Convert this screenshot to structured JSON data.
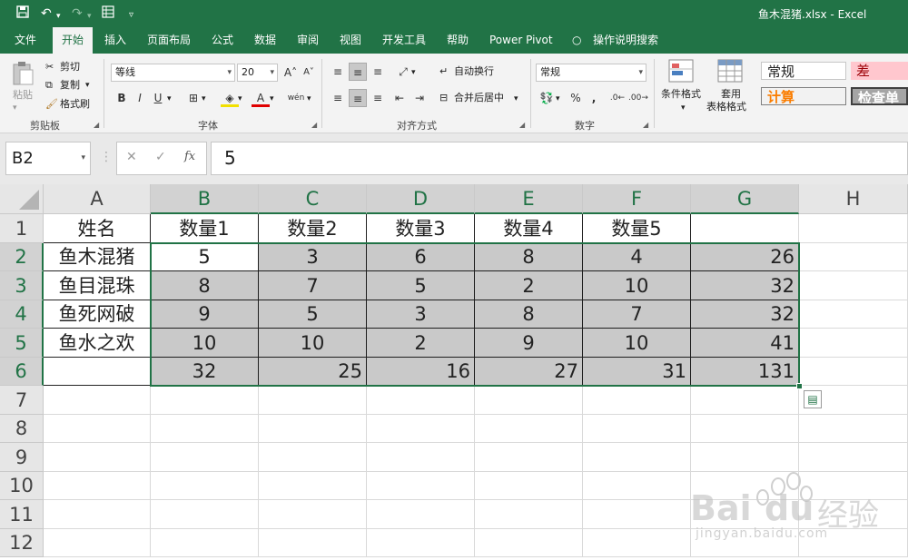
{
  "window": {
    "title": "鱼木混猪.xlsx  -  Excel",
    "quick_access": {
      "save": "save-icon",
      "undo": "undo-icon",
      "redo": "redo-icon",
      "form": "form-icon",
      "customize": "customize-icon"
    }
  },
  "tabs": [
    "文件",
    "开始",
    "插入",
    "页面布局",
    "公式",
    "数据",
    "审阅",
    "视图",
    "开发工具",
    "帮助",
    "Power Pivot",
    "操作说明搜索"
  ],
  "active_tab": "开始",
  "ribbon": {
    "clipboard": {
      "paste": "粘贴",
      "cut": "剪切",
      "copy": "复制",
      "format_painter": "格式刷",
      "label": "剪贴板"
    },
    "font": {
      "name": "等线",
      "size": "20",
      "grow": "A˄",
      "shrink": "A˅",
      "bold": "B",
      "italic": "I",
      "underline": "U",
      "phonetic": "wén",
      "label": "字体"
    },
    "alignment": {
      "wrap": "自动换行",
      "merge": "合并后居中",
      "label": "对齐方式"
    },
    "number": {
      "format": "常规",
      "percent": "%",
      "comma": ",",
      "label": "数字"
    },
    "styles": {
      "conditional": "条件格式",
      "table_line1": "套用",
      "table_line2": "表格格式",
      "normal": "常规",
      "bad": "差",
      "calc": "计算",
      "check": "检查单"
    }
  },
  "formula_bar": {
    "name_box": "B2",
    "cancel": "✕",
    "enter": "✓",
    "fx": "fx",
    "value": "5"
  },
  "sheet": {
    "columns": [
      "A",
      "B",
      "C",
      "D",
      "E",
      "F",
      "G",
      "H"
    ],
    "rows": [
      "1",
      "2",
      "3",
      "4",
      "5",
      "6",
      "7",
      "8",
      "9",
      "10",
      "11",
      "12"
    ],
    "headers": [
      "姓名",
      "数量1",
      "数量2",
      "数量3",
      "数量4",
      "数量5"
    ],
    "data": [
      [
        "鱼木混猪",
        "5",
        "3",
        "6",
        "8",
        "4",
        "26"
      ],
      [
        "鱼目混珠",
        "8",
        "7",
        "5",
        "2",
        "10",
        "32"
      ],
      [
        "鱼死网破",
        "9",
        "5",
        "3",
        "8",
        "7",
        "32"
      ],
      [
        "鱼水之欢",
        "10",
        "10",
        "2",
        "9",
        "10",
        "41"
      ]
    ],
    "totals": [
      "32",
      "25",
      "16",
      "27",
      "31",
      "131"
    ]
  },
  "watermark": {
    "brand": "Bai",
    "brand2": "du",
    "cn": "经验",
    "url": "jingyan.baidu.com"
  },
  "colors": {
    "excel_green": "#217346",
    "selection_fill": "#c9c9c9"
  }
}
